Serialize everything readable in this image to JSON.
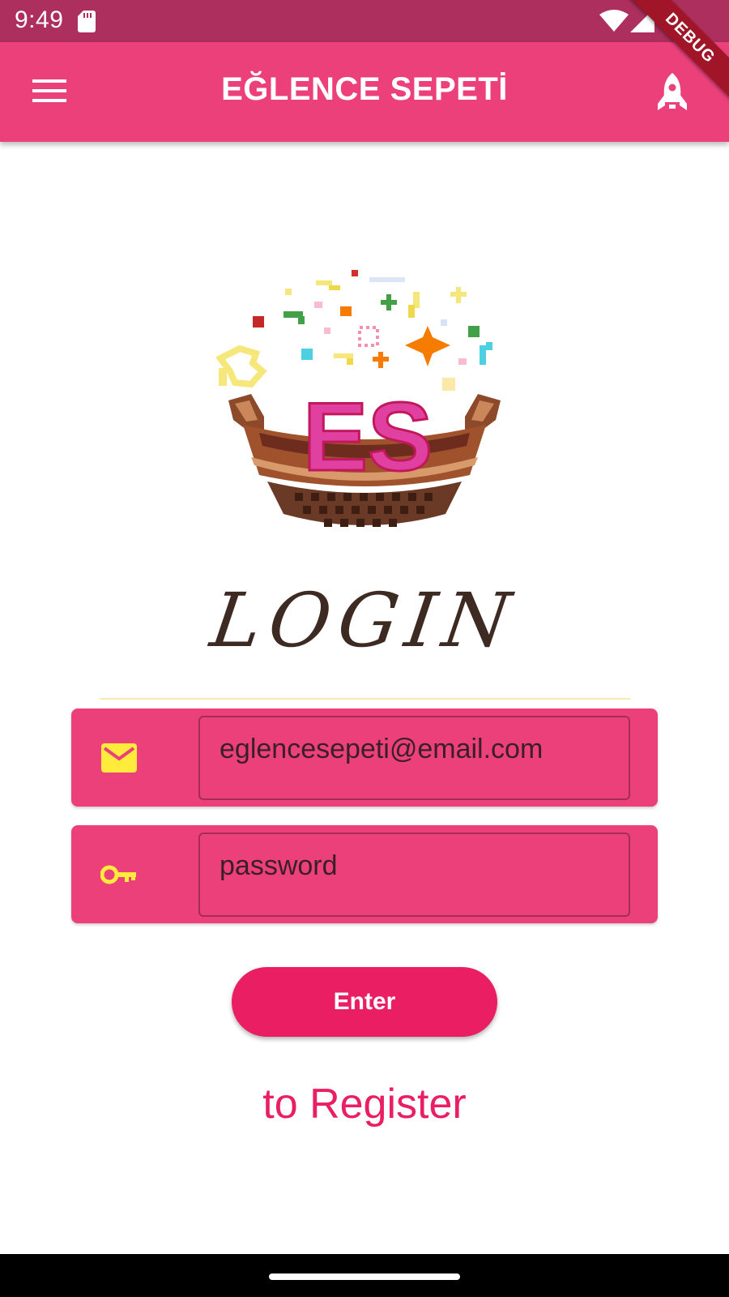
{
  "status_bar": {
    "time": "9:49"
  },
  "app_bar": {
    "title": "EĞLENCE SEPETİ",
    "menu_icon": "hamburger-menu-icon",
    "action_icon": "rocket-icon"
  },
  "debug_banner": {
    "label": "DEBUG"
  },
  "logo": {
    "initials": "ES"
  },
  "login": {
    "heading": "LOGIN"
  },
  "form": {
    "email": {
      "icon": "mail-icon",
      "value": "eglencesepeti@email.com"
    },
    "password": {
      "icon": "key-icon",
      "value": "password"
    },
    "enter_label": "Enter",
    "register_label": "to Register"
  },
  "colors": {
    "status_bar": "#ad2f5e",
    "app_bar": "#ec407a",
    "card": "#ec407a",
    "button": "#e91e63",
    "icon_accent": "#ffeb3b",
    "register_text": "#e91e63"
  }
}
